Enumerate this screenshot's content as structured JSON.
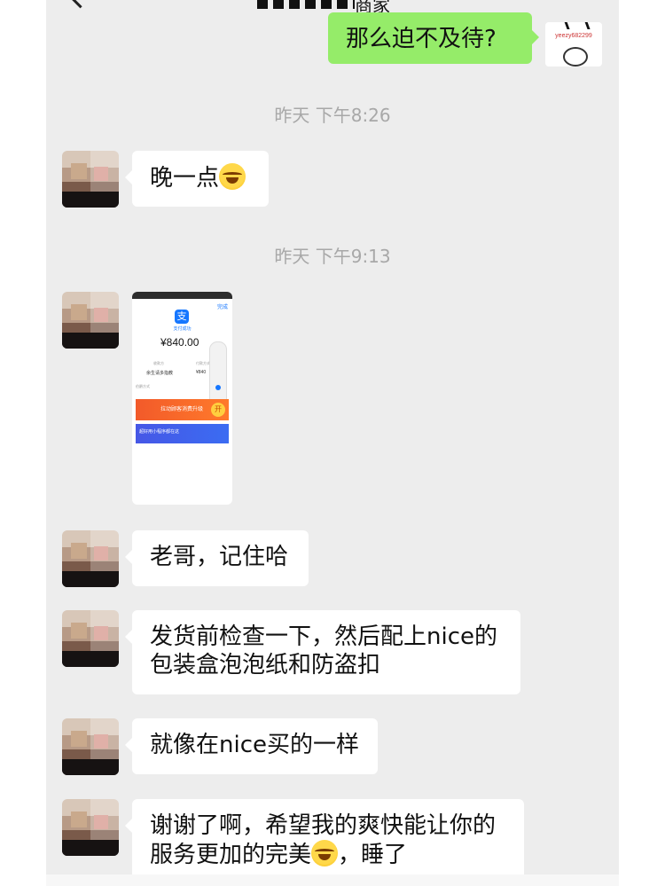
{
  "header": {
    "title_fragment": "商家"
  },
  "messages": {
    "m1": "那么迫不及待?",
    "ts1": "昨天 下午8:26",
    "m2": "晚一点",
    "ts2": "昨天 下午9:13",
    "m3": "老哥，记住哈",
    "m4_line1": "发货前检查一下，然后配上nice的",
    "m4_line2": "包装盒泡泡纸和防盗扣",
    "m5": "就像在nice买的一样",
    "m6_line1": "谢谢了啊，希望我的爽快能让你的",
    "m6_line2_a": "服务更加的完美",
    "m6_line2_b": "，睡了"
  },
  "my_avatar": {
    "text": "yeezy682299",
    "brand": "YEEZY"
  },
  "image_message": {
    "status": "支付成功",
    "done": "完成",
    "amount": "¥840.00",
    "label1": "收款方",
    "value1": "余生请多指教",
    "label2": "付款方式",
    "value2": "¥840",
    "label3": "伯爵方式",
    "banner1": "拉动顾客消费升级",
    "banner1_btn": "开",
    "banner2": "超好用小程序都在这"
  }
}
